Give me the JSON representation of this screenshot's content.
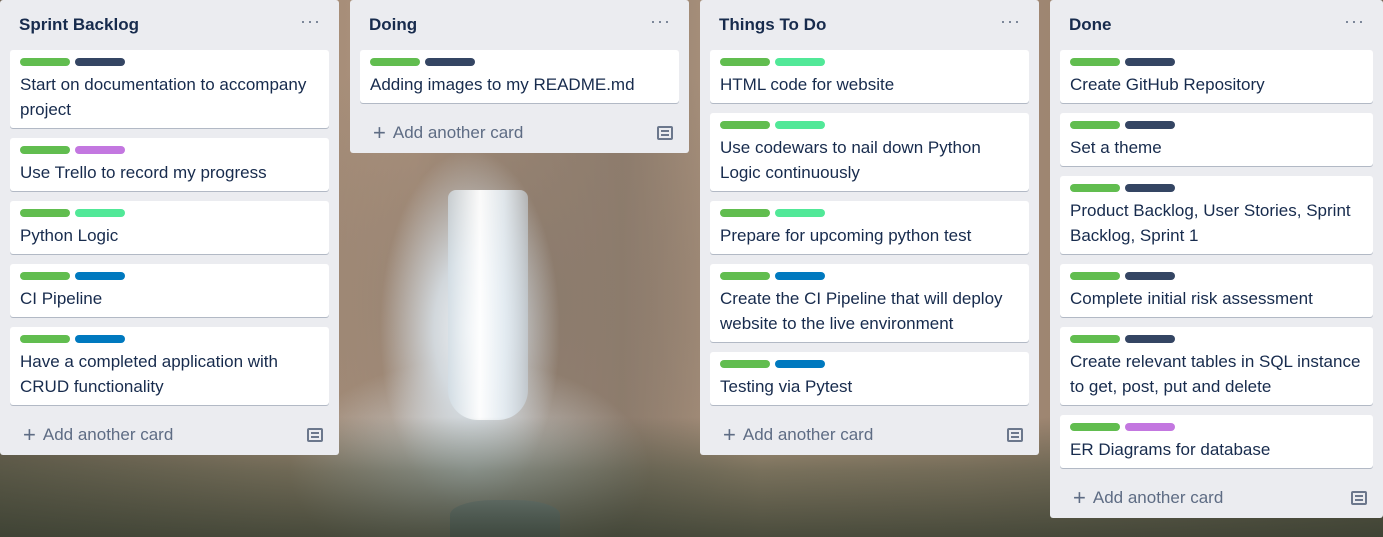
{
  "colors": {
    "green": "#61bd4f",
    "navy": "#344563",
    "purple": "#c377e0",
    "lime": "#51e898",
    "blue": "#0079bf"
  },
  "add_card_label": "Add another card",
  "menu_glyph": "···",
  "lists": [
    {
      "title": "Sprint Backlog",
      "cards": [
        {
          "title": "Start on documentation to accompany project",
          "labels": [
            "green",
            "navy"
          ]
        },
        {
          "title": "Use Trello to record my progress",
          "labels": [
            "green",
            "purple"
          ]
        },
        {
          "title": "Python Logic",
          "labels": [
            "green",
            "lime"
          ]
        },
        {
          "title": "CI Pipeline",
          "labels": [
            "green",
            "blue"
          ]
        },
        {
          "title": "Have a completed application with CRUD functionality",
          "labels": [
            "green",
            "blue"
          ]
        }
      ]
    },
    {
      "title": "Doing",
      "cards": [
        {
          "title": "Adding images to my README.md",
          "labels": [
            "green",
            "navy"
          ]
        }
      ]
    },
    {
      "title": "Things To Do",
      "cards": [
        {
          "title": "HTML code for website",
          "labels": [
            "green",
            "lime"
          ]
        },
        {
          "title": "Use codewars to nail down Python Logic continuously",
          "labels": [
            "green",
            "lime"
          ]
        },
        {
          "title": "Prepare for upcoming python test",
          "labels": [
            "green",
            "lime"
          ]
        },
        {
          "title": "Create the CI Pipeline that will deploy website to the live environment",
          "labels": [
            "green",
            "blue"
          ]
        },
        {
          "title": "Testing via Pytest",
          "labels": [
            "green",
            "blue"
          ]
        }
      ]
    },
    {
      "title": "Done",
      "cards": [
        {
          "title": "Create GitHub Repository",
          "labels": [
            "green",
            "navy"
          ]
        },
        {
          "title": "Set a theme",
          "labels": [
            "green",
            "navy"
          ]
        },
        {
          "title": "Product Backlog, User Stories, Sprint Backlog, Sprint 1",
          "labels": [
            "green",
            "navy"
          ]
        },
        {
          "title": "Complete initial risk assessment",
          "labels": [
            "green",
            "navy"
          ]
        },
        {
          "title": "Create relevant tables in SQL instance to get, post, put and delete",
          "labels": [
            "green",
            "navy"
          ]
        },
        {
          "title": "ER Diagrams for database",
          "labels": [
            "green",
            "purple"
          ]
        }
      ]
    }
  ]
}
